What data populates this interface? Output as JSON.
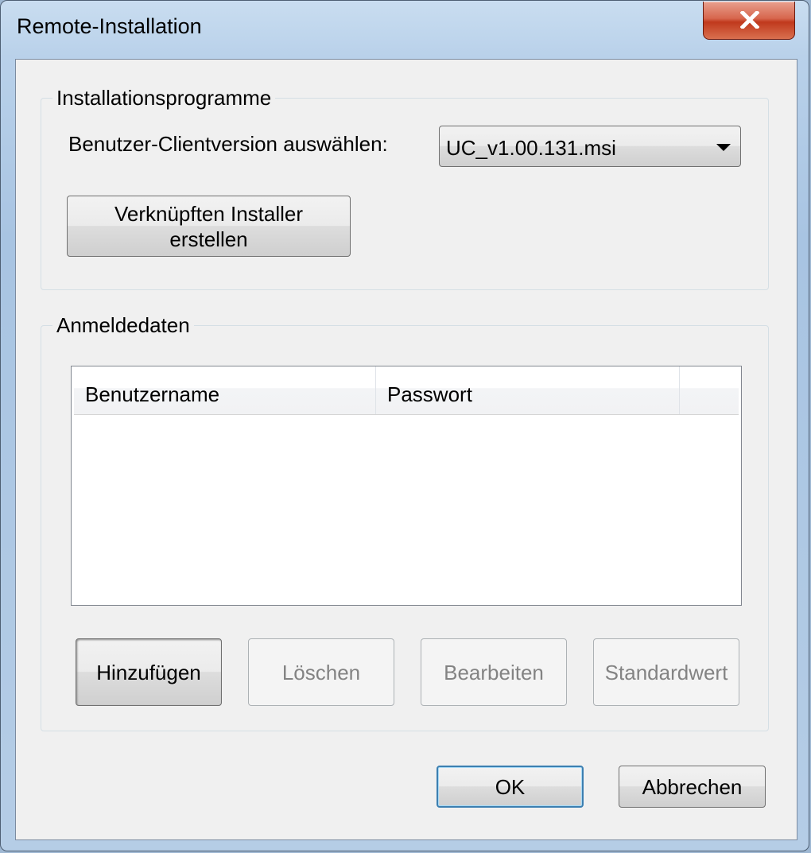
{
  "window": {
    "title": "Remote-Installation"
  },
  "installers": {
    "group_label": "Installationsprogramme",
    "client_version_label": "Benutzer-Clientversion auswählen:",
    "client_version_value": "UC_v1.00.131.msi",
    "create_installer_line1": "Verknüpften Installer",
    "create_installer_line2": "erstellen"
  },
  "credentials": {
    "group_label": "Anmeldedaten",
    "columns": [
      "Benutzername",
      "Passwort",
      ""
    ],
    "rows": [],
    "add_label": "Hinzufügen",
    "delete_label": "Löschen",
    "edit_label": "Bearbeiten",
    "default_label": "Standardwert"
  },
  "footer": {
    "ok_label": "OK",
    "cancel_label": "Abbrechen"
  },
  "icons": {
    "close": "close-icon",
    "dropdown": "chevron-down-icon"
  },
  "colors": {
    "close_button": "#c0391d",
    "dialog_background": "#f0f0f0",
    "default_button_border": "#3c7fb1"
  }
}
